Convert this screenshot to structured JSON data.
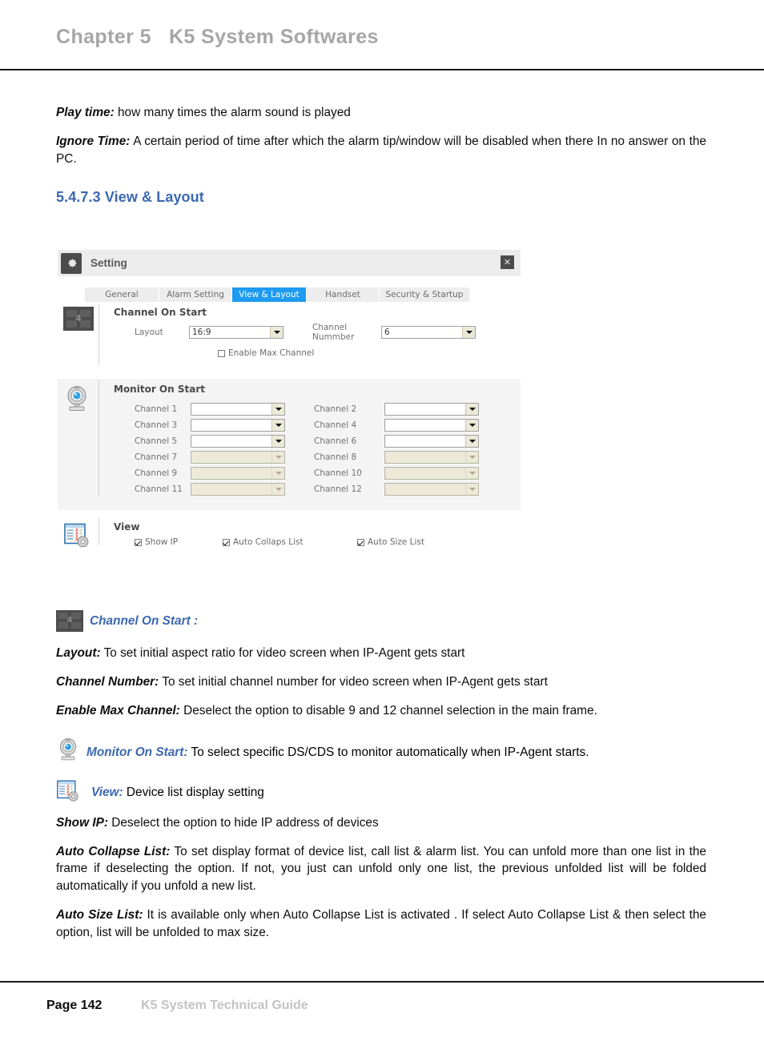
{
  "header": {
    "chapter_title": "Chapter 5   K5 System Softwares"
  },
  "intro": {
    "play_time_label": "Play time:",
    "play_time_text": " how many times the alarm sound is played",
    "ignore_time_label": "Ignore Time:",
    "ignore_time_text": " A certain period of time after which the alarm tip/window will be disabled when there  In no answer on the PC."
  },
  "section": {
    "heading": "5.4.7.3 View & Layout"
  },
  "dialog": {
    "title": "Setting",
    "gear_icon": "gear-icon",
    "close_icon": "close-icon",
    "tabs": [
      {
        "label": "General",
        "active": false
      },
      {
        "label": "Alarm Setting",
        "active": false
      },
      {
        "label": "View & Layout",
        "active": true
      },
      {
        "label": "Handset",
        "active": false
      },
      {
        "label": "Security & Startup",
        "active": false
      }
    ],
    "channel_on_start": {
      "icon": "grid-4-layout-icon",
      "icon_badge": "4",
      "group_label": "Channel On Start",
      "layout_label": "Layout",
      "layout_value": "16:9",
      "channel_number_label": "Channel Nummber",
      "channel_number_value": "6",
      "enable_max_channel_label": "Enable Max Channel",
      "enable_max_channel_checked": false
    },
    "monitor_on_start": {
      "icon": "webcam-icon",
      "group_label": "Monitor On Start",
      "channels": [
        {
          "label": "Channel  1",
          "value": "",
          "enabled": true
        },
        {
          "label": "Channel  2",
          "value": "",
          "enabled": true
        },
        {
          "label": "Channel  3",
          "value": "",
          "enabled": true
        },
        {
          "label": "Channel  4",
          "value": "",
          "enabled": true
        },
        {
          "label": "Channel  5",
          "value": "",
          "enabled": true
        },
        {
          "label": "Channel  6",
          "value": "",
          "enabled": true
        },
        {
          "label": "Channel  7",
          "value": "",
          "enabled": false
        },
        {
          "label": "Channel  8",
          "value": "",
          "enabled": false
        },
        {
          "label": "Channel  9",
          "value": "",
          "enabled": false
        },
        {
          "label": "Channel  10",
          "value": "",
          "enabled": false
        },
        {
          "label": "Channel  11",
          "value": "",
          "enabled": false
        },
        {
          "label": "Channel  12",
          "value": "",
          "enabled": false
        }
      ]
    },
    "view": {
      "icon": "list-settings-icon",
      "group_label": "View",
      "checkboxes": [
        {
          "label": "Show IP",
          "checked": true
        },
        {
          "label": "Auto Collaps List",
          "checked": true
        },
        {
          "label": "Auto Size List",
          "checked": true
        }
      ]
    }
  },
  "notes": {
    "channel_on_start": {
      "icon": "grid-4-layout-icon",
      "icon_badge": "4",
      "title": "Channel On Start :"
    },
    "layout_label": "Layout:",
    "layout_text": " To set initial aspect ratio for video screen when IP-Agent gets start",
    "channel_number_label": "Channel Number:",
    "channel_number_text": " To set initial channel number for video screen when IP-Agent gets start",
    "enable_max_channel_label": "Enable Max Channel:",
    "enable_max_channel_text": " Deselect the option to disable 9 and 12 channel selection in the main frame.",
    "monitor_on_start": {
      "icon": "webcam-icon",
      "title": "Monitor On Start:",
      "text": " To select specific DS/CDS to monitor automatically when IP-Agent starts."
    },
    "view": {
      "icon": "list-settings-icon",
      "title": "View:",
      "text": " Device list display setting"
    },
    "show_ip_label": "Show IP:",
    "show_ip_text": " Deselect the option to hide IP address of devices",
    "auto_collapse_label": "Auto Collapse List:",
    "auto_collapse_text": " To set display format of device list, call list & alarm list. You can unfold more than one list in the frame if deselecting the option. If not, you just can unfold only one list, the previous unfolded list will be folded automatically if you unfold a new list.",
    "auto_size_label": "Auto Size List:",
    "auto_size_text": " It is available only when Auto Collapse List is activated . If select Auto Collapse List & then select the option, list will be unfolded to max size."
  },
  "footer": {
    "page": "Page 142",
    "guide": "K5 System Technical Guide"
  },
  "colors": {
    "accent_blue": "#3b68b0",
    "tab_active": "#1e9bf0",
    "header_grey": "#a6a6a6"
  }
}
